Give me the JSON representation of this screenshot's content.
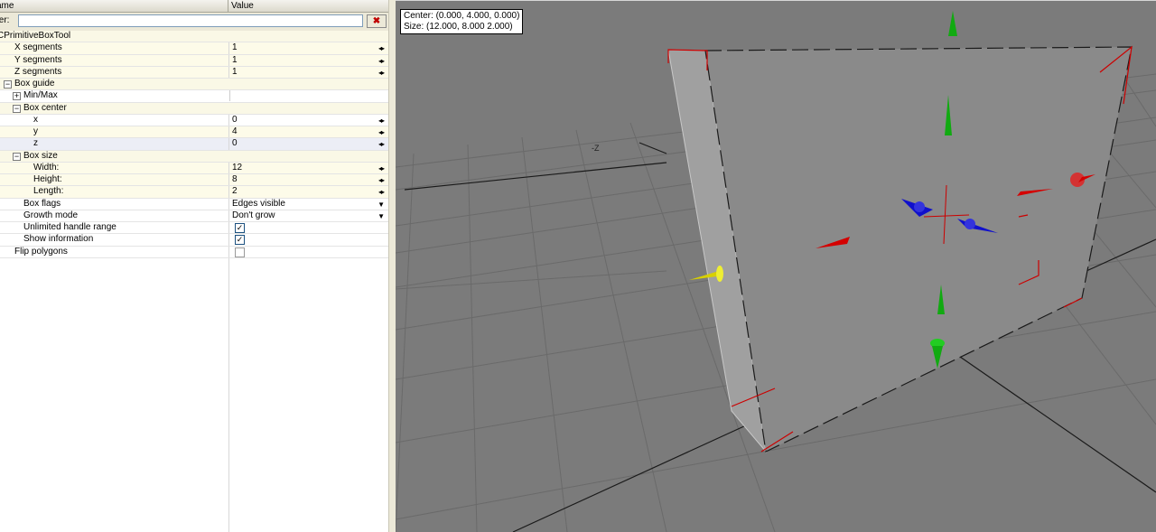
{
  "property_grid": {
    "header": {
      "name_col": "ame",
      "value_col": "Value"
    },
    "filter": {
      "label": "ter:",
      "value": "",
      "clear_icon": "close-x-icon"
    },
    "root": "CPrimitiveBoxTool",
    "rows": {
      "x_segments": {
        "label": "X segments",
        "value": "1"
      },
      "y_segments": {
        "label": "Y segments",
        "value": "1"
      },
      "z_segments": {
        "label": "Z segments",
        "value": "1"
      },
      "box_guide": {
        "label": "Box guide"
      },
      "min_max": {
        "label": "Min/Max"
      },
      "box_center": {
        "label": "Box center"
      },
      "center_x": {
        "label": "x",
        "value": "0"
      },
      "center_y": {
        "label": "y",
        "value": "4"
      },
      "center_z": {
        "label": "z",
        "value": "0"
      },
      "box_size": {
        "label": "Box size"
      },
      "width": {
        "label": "Width:",
        "value": "12"
      },
      "height": {
        "label": "Height:",
        "value": "8"
      },
      "length": {
        "label": "Length:",
        "value": "2"
      },
      "box_flags": {
        "label": "Box flags",
        "value": "Edges visible"
      },
      "growth_mode": {
        "label": "Growth mode",
        "value": "Don't grow"
      },
      "unlimited_handle_range": {
        "label": "Unlimited handle range",
        "checked": true
      },
      "show_information": {
        "label": "Show information",
        "checked": true
      },
      "flip_polygons": {
        "label": "Flip polygons",
        "checked": false
      }
    },
    "glyphs": {
      "spin": "◂▸",
      "dropdown": "▼",
      "check": "✓",
      "expand": "+",
      "collapse": "−"
    }
  },
  "viewport": {
    "info": {
      "center": "Center: (0.000, 4.000, 0.000)",
      "size": "Size: (12.000, 8.000 2.000)"
    },
    "axis_label": "-Z",
    "colors": {
      "background": "#7b7b7b",
      "grid": "#6a6a6a",
      "box_face": "#8a8a8a",
      "box_side": "#a0a0a0",
      "handle_red": "#d40000",
      "handle_green": "#11aa11",
      "handle_blue": "#1010cc",
      "handle_yellow": "#d8d000"
    }
  }
}
